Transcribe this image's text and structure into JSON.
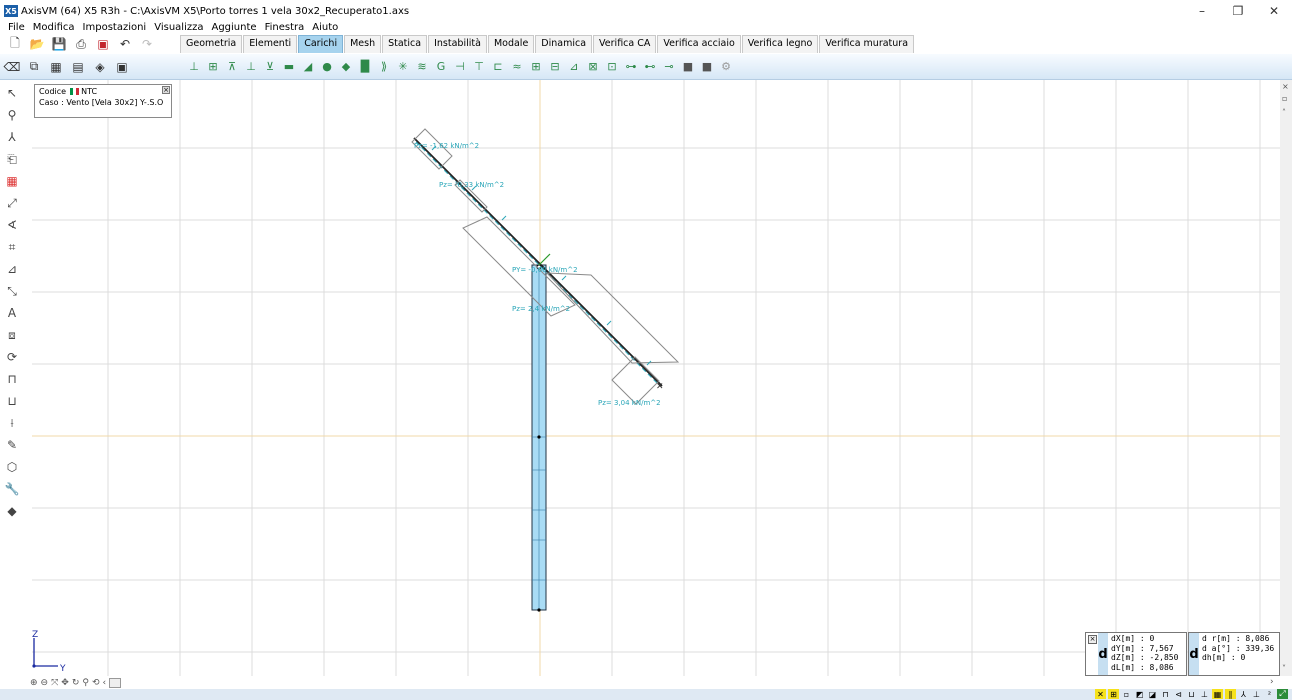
{
  "window": {
    "title": "AxisVM (64) X5 R3h - C:\\AxisVM X5\\Porto torres 1 vela 30x2_Recuperato1.axs",
    "logo_text": "X5",
    "minimize": "–",
    "maximize": "❐",
    "close": "✕"
  },
  "menu": [
    "File",
    "Modifica",
    "Impostazioni",
    "Visualizza",
    "Aggiunte",
    "Finestra",
    "Aiuto"
  ],
  "tabs": [
    {
      "label": "Geometria",
      "active": false
    },
    {
      "label": "Elementi",
      "active": false
    },
    {
      "label": "Carichi",
      "active": true
    },
    {
      "label": "Mesh",
      "active": false
    },
    {
      "label": "Statica",
      "active": false
    },
    {
      "label": "Instabilità",
      "active": false
    },
    {
      "label": "Modale",
      "active": false
    },
    {
      "label": "Dinamica",
      "active": false
    },
    {
      "label": "Verifica CA",
      "active": false
    },
    {
      "label": "Verifica acciaio",
      "active": false
    },
    {
      "label": "Verifica legno",
      "active": false
    },
    {
      "label": "Verifica muratura",
      "active": false
    }
  ],
  "infobox": {
    "code_label": "Codice",
    "code_value": "NTC",
    "case_label": "Caso",
    "case_value": ": Vento [Vela 30x2] Y-.S.O"
  },
  "load_labels": {
    "l1": "Pz= -1,62 kN/m^2",
    "l2": "Pz= -0,33 kN/m^2",
    "l3": "PY= -0,60 kN/m^2",
    "l4": "Pz= 2,4 kN/m^2",
    "l5": "Pz= 3,04 kN/m^2"
  },
  "axis": {
    "z": "Z",
    "y": "Y"
  },
  "coord_left": {
    "dx": "dX[m] : 0",
    "dy": "dY[m] : 7,567",
    "dz": "dZ[m] : -2,850",
    "dl": "dL[m] : 8,086"
  },
  "coord_right": {
    "dr": "d r[m] : 8,086",
    "da": "d a[°] : 339,36",
    "dh": "dh[m] : 0"
  },
  "coord_tag": "d",
  "colors": {
    "grid": "#d9d9d9",
    "column_fill": "#a9dcf5",
    "load_color": "#2aa6b8",
    "tab_active": "#a6d3ee"
  }
}
